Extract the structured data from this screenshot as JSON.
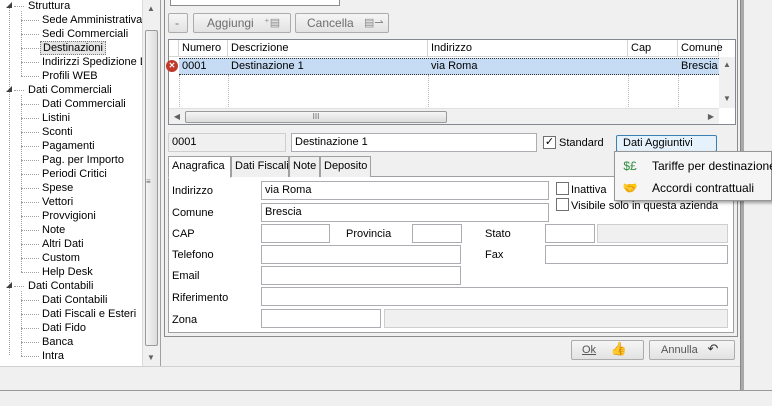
{
  "tree": {
    "items": [
      {
        "label": "Struttura",
        "level": 0,
        "expander": true
      },
      {
        "label": "Sede Amministrativa",
        "level": 1
      },
      {
        "label": "Sedi Commerciali",
        "level": 1
      },
      {
        "label": "Destinazioni",
        "level": 1,
        "selected": true
      },
      {
        "label": "Indirizzi Spedizione D",
        "level": 1
      },
      {
        "label": "Profili WEB",
        "level": 1
      },
      {
        "label": "Dati Commerciali",
        "level": 0,
        "expander": true
      },
      {
        "label": "Dati Commerciali",
        "level": 1
      },
      {
        "label": "Listini",
        "level": 1
      },
      {
        "label": "Sconti",
        "level": 1
      },
      {
        "label": "Pagamenti",
        "level": 1
      },
      {
        "label": "Pag. per Importo",
        "level": 1
      },
      {
        "label": "Periodi Critici",
        "level": 1
      },
      {
        "label": "Spese",
        "level": 1
      },
      {
        "label": "Vettori",
        "level": 1
      },
      {
        "label": "Provvigioni",
        "level": 1
      },
      {
        "label": "Note",
        "level": 1
      },
      {
        "label": "Altri Dati",
        "level": 1
      },
      {
        "label": "Custom",
        "level": 1
      },
      {
        "label": "Help Desk",
        "level": 1
      },
      {
        "label": "Dati Contabili",
        "level": 0,
        "expander": true
      },
      {
        "label": "Dati Contabili",
        "level": 1
      },
      {
        "label": "Dati Fiscali e Esteri",
        "level": 1
      },
      {
        "label": "Dati Fido",
        "level": 1
      },
      {
        "label": "Banca",
        "level": 1
      },
      {
        "label": "Intra",
        "level": 1
      }
    ]
  },
  "toolbar": {
    "minus_label": "-",
    "add_label": "Aggiungi",
    "delete_label": "Cancella"
  },
  "grid": {
    "columns": [
      "Numero",
      "Descrizione",
      "Indirizzo",
      "Cap",
      "Comune"
    ],
    "rows": [
      {
        "numero": "0001",
        "descrizione": "Destinazione 1",
        "indirizzo": "via Roma",
        "cap": "",
        "comune": "Brescia"
      }
    ],
    "hscroll_grip": "III"
  },
  "detail": {
    "code": "0001",
    "description": "Destinazione 1",
    "standard_label": "Standard",
    "standard_checked": true,
    "extra_button": "Dati Aggiuntivi"
  },
  "tabs": [
    "Anagrafica",
    "Dati Fiscali",
    "Note",
    "Deposito"
  ],
  "form": {
    "indirizzo_label": "Indirizzo",
    "indirizzo_value": "via Roma",
    "comune_label": "Comune",
    "comune_value": "Brescia",
    "cap_label": "CAP",
    "cap_value": "",
    "provincia_label": "Provincia",
    "provincia_value": "",
    "stato_label": "Stato",
    "stato_value": "",
    "telefono_label": "Telefono",
    "telefono_value": "",
    "fax_label": "Fax",
    "fax_value": "",
    "email_label": "Email",
    "email_value": "",
    "riferimento_label": "Riferimento",
    "riferimento_value": "",
    "zona_label": "Zona",
    "zona_value": "",
    "inattiva_label": "Inattiva",
    "visibile_label": "Visibile solo in questa azienda"
  },
  "menu": {
    "items": [
      {
        "label": "Tariffe per destinazione",
        "icon": "tariff-icon"
      },
      {
        "label": "Accordi contrattuali",
        "icon": "handshake-icon"
      }
    ]
  },
  "footer": {
    "ok_label": "Ok",
    "cancel_label": "Annulla"
  }
}
